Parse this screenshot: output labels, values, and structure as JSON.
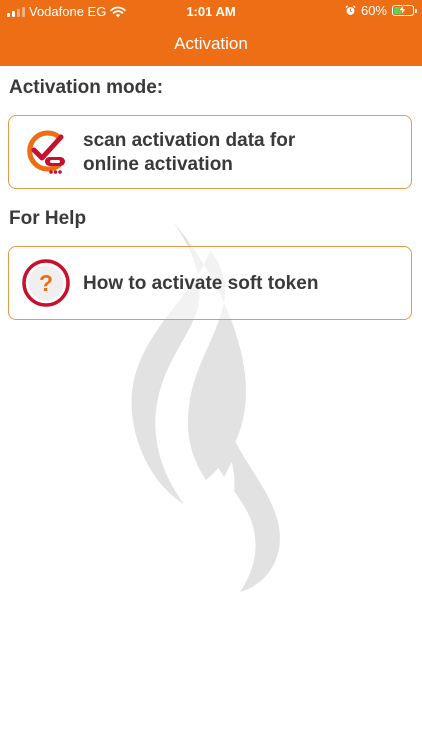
{
  "status_bar": {
    "carrier": "Vodafone EG",
    "time": "1:01 AM",
    "battery_percent": "60%",
    "battery_level": 0.6,
    "icons": [
      "signal-icon",
      "wifi-icon",
      "alarm-icon",
      "battery-charging-icon"
    ]
  },
  "nav": {
    "title": "Activation"
  },
  "activation_section": {
    "heading": "Activation mode:",
    "options": [
      {
        "label_line1": "scan activation data for",
        "label_line2": "online activation",
        "icon": "scan-check-icon"
      }
    ]
  },
  "help_section": {
    "heading": "For Help",
    "options": [
      {
        "label": "How to activate soft token",
        "icon": "question-icon"
      }
    ]
  },
  "colors": {
    "brand_orange": "#ee6e16",
    "card_border": "#e59a4a",
    "icon_red": "#c8102e",
    "text_dark": "#3a3a3a",
    "watermark_gray": "#e2e2e2"
  }
}
